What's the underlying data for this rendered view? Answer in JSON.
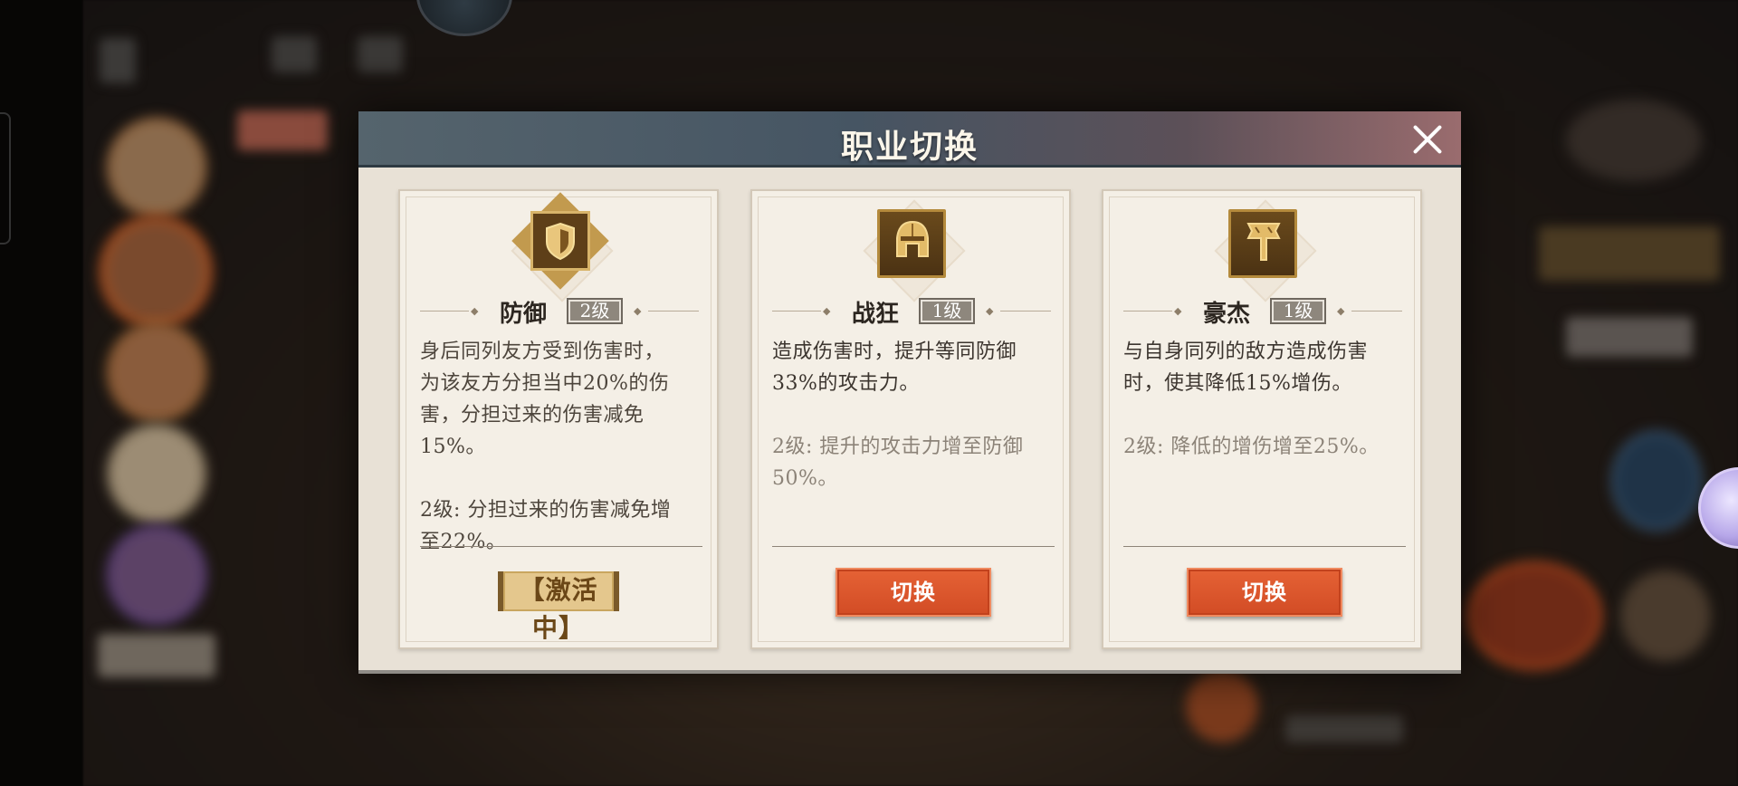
{
  "dialog": {
    "title": "职业切换",
    "close_icon": "close-icon"
  },
  "classes": [
    {
      "name": "防御",
      "level": "2级",
      "icon": "shield-icon",
      "description_lines": [
        "身后同列友方受到伤害时，",
        "为该友方分担当中20%的伤",
        "害，分担过来的伤害减免",
        "15%。"
      ],
      "upgrade_lines": [
        "2级: 分担过来的伤害减免增",
        "至22%。"
      ],
      "status": "【激活中】"
    },
    {
      "name": "战狂",
      "level": "1级",
      "icon": "helmet-icon",
      "description_lines": [
        "造成伤害时，提升等同防御",
        "33%的攻击力。"
      ],
      "upgrade_lines": [
        "2级: 提升的攻击力增至防御",
        "50%。"
      ],
      "button_label": "切换"
    },
    {
      "name": "豪杰",
      "level": "1级",
      "icon": "banner-icon",
      "description_lines": [
        "与自身同列的敌方造成伤害",
        "时，使其降低15%增伤。"
      ],
      "upgrade_lines": [
        "2级: 降低的增伤增至25%。"
      ],
      "button_label": "切换"
    }
  ],
  "colors": {
    "switch_button": "#d8532a",
    "active_badge": "#e4c78d",
    "title_bar": "#4a5966",
    "card_bg": "#f4efe6"
  }
}
